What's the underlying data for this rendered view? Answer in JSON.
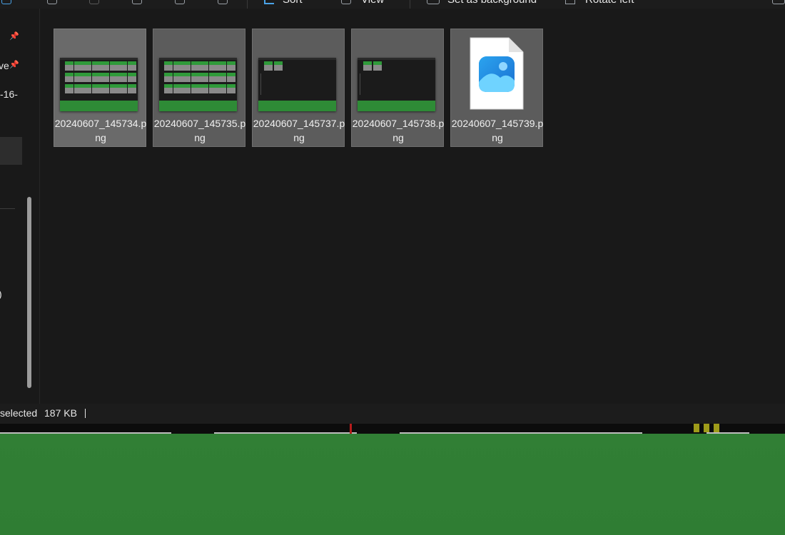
{
  "toolbar": {
    "sort_label": "Sort",
    "view_label": "View",
    "background_label": "Set as background",
    "rotate_label": "Rotate left"
  },
  "sidebar": {
    "item_suffix_1": "ve",
    "item_fragment_2": "-16-",
    "item_fragment_3": ")"
  },
  "files": [
    {
      "name": "20240607_145734.png",
      "thumb": "grid"
    },
    {
      "name": "20240607_145735.png",
      "thumb": "grid"
    },
    {
      "name": "20240607_145737.png",
      "thumb": "sparse"
    },
    {
      "name": "20240607_145738.png",
      "thumb": "sparse"
    },
    {
      "name": "20240607_145739.png",
      "thumb": "photos-icon"
    }
  ],
  "status": {
    "selected": "selected",
    "size": "187 KB"
  },
  "colors": {
    "accent": "#4aa3e8",
    "desktop_green": "#2e7d32",
    "thumb_green": "#2e8b36"
  }
}
